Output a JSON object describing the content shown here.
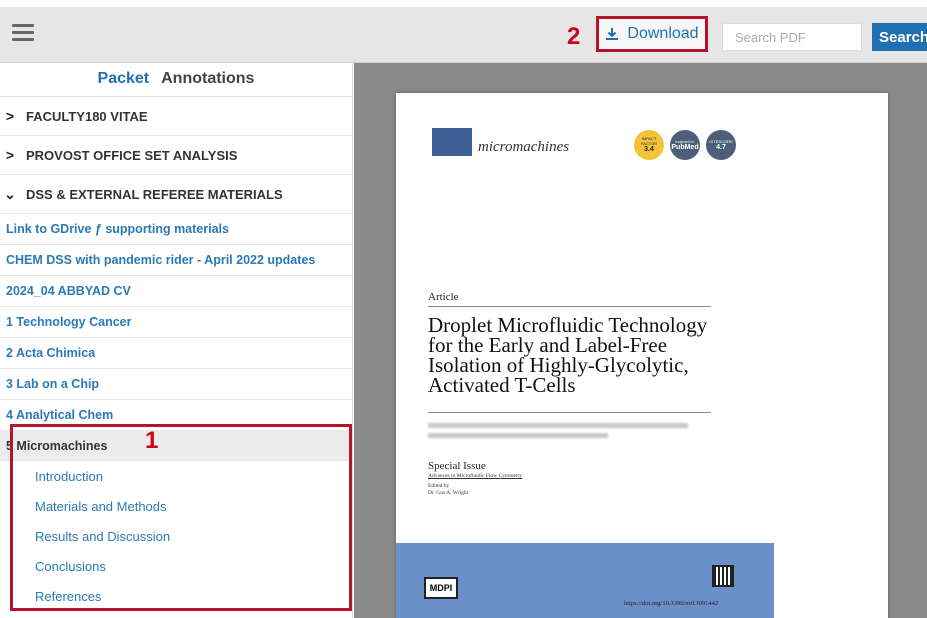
{
  "topbar": {
    "download_label": "Download",
    "search_placeholder": "Search PDF",
    "search_button": "Search",
    "marker_2": "2"
  },
  "sidebar": {
    "tabs": [
      "Packet",
      "Annotations"
    ],
    "sections": [
      {
        "label": "FACULTY180 VITAE",
        "expanded": false
      },
      {
        "label": "PROVOST OFFICE SET ANALYSIS",
        "expanded": false
      },
      {
        "label": "DSS & EXTERNAL REFEREE MATERIALS",
        "expanded": true
      }
    ],
    "documents": [
      "Link to GDrive ƒ supporting materials",
      "CHEM DSS with pandemic rider - April 2022 updates",
      "2024_04 ABBYAD CV",
      "1 Technology Cancer",
      "2 Acta Chimica",
      "3 Lab on a Chip",
      "4 Analytical Chem"
    ],
    "active_document": "5 Micromachines",
    "marker_1": "1",
    "subsections": [
      "Introduction",
      "Materials and Methods",
      "Results and Discussion",
      "Conclusions",
      "References"
    ]
  },
  "pdf": {
    "journal": "micromachines",
    "badges": [
      {
        "top": "IMPACT FACTOR",
        "value": "3.4"
      },
      {
        "top": "Indexed in:",
        "value": "PubMed"
      },
      {
        "top": "CITESCORE",
        "value": "4.7"
      }
    ],
    "article_label": "Article",
    "title": "Droplet Microfluidic Technology for the Early and Label-Free Isolation of Highly-Glycolytic, Activated T-Cells",
    "special_issue": "Special Issue",
    "special_issue_name": "Advances in Microfluidic Flow Cytometry",
    "edited_by": "Edited by",
    "editor": "Dr. Gus A. Wright",
    "publisher": "MDPI",
    "doi": "https://doi.org/10.3390/mi13091442"
  },
  "colors": {
    "accent": "#1f6fb3",
    "highlight": "#b5142b",
    "annotation": "#d0021b"
  }
}
